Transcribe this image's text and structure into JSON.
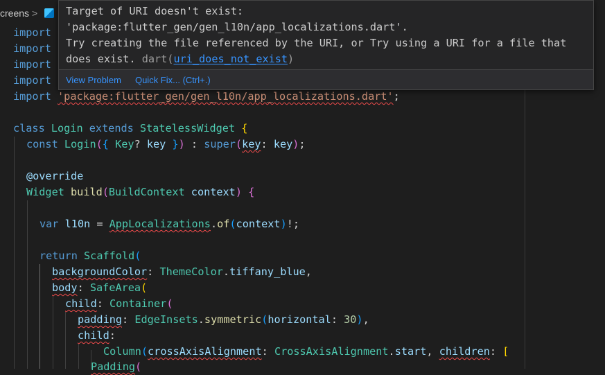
{
  "breadcrumb": {
    "folder": "creens",
    "separator": ">",
    "file_icon": "dart-file-icon"
  },
  "hover": {
    "line1": "Target of URI doesn't exist:",
    "line2": "'package:flutter_gen/gen_l10n/app_localizations.dart'.",
    "line3": "Try creating the file referenced by the URI, or Try using a URI for a file that",
    "line4_prefix": "does exist. ",
    "source": "dart(",
    "code": "uri_does_not_exist",
    "source_close": ")",
    "view_problem": "View Problem",
    "quick_fix": "Quick Fix... (Ctrl+.)"
  },
  "code": {
    "import_kw": "import",
    "import_path": "'package:flutter_gen/gen_l10n/app_localizations.dart'",
    "semicolon": ";",
    "class_kw": "class",
    "class_name": "Login",
    "extends_kw": "extends",
    "base_class": "StatelessWidget",
    "const_kw": "const",
    "ctor_name": "Login",
    "key_type": "Key",
    "key_param": "key",
    "super_kw": "super",
    "key_arg": "key",
    "key_val": "key",
    "override": "@override",
    "widget_type": "Widget",
    "build_fn": "build",
    "ctx_type": "BuildContext",
    "ctx_param": "context",
    "var_kw": "var",
    "l10n_var": "l10n",
    "app_loc": "AppLocalizations",
    "of_fn": "of",
    "ctx_arg": "context",
    "return_kw": "return",
    "scaffold": "Scaffold",
    "bg_prop": "backgroundColor",
    "theme_color": "ThemeColor",
    "tiffany": "tiffany_blue",
    "body_prop": "body",
    "safe_area": "SafeArea",
    "child_prop": "child",
    "container": "Container",
    "padding_prop": "padding",
    "edge_insets": "EdgeInsets",
    "symmetric_fn": "symmetric",
    "horizontal_prop": "horizontal",
    "horizontal_val": "30",
    "child_prop2": "child",
    "column": "Column",
    "cross_prop": "crossAxisAlignment",
    "cross_enum": "CrossAxisAlignment",
    "start_val": "start",
    "children_prop": "children",
    "padding_widget": "Padding"
  }
}
